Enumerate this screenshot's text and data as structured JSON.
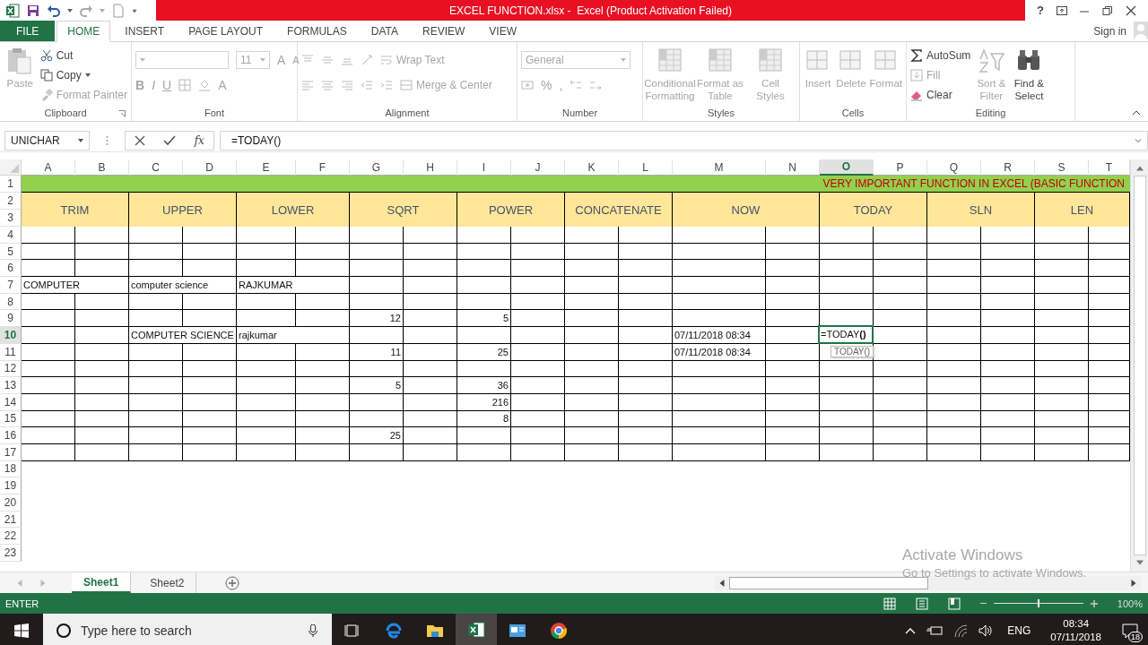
{
  "title_bar": {
    "title": "EXCEL FUNCTION.xlsx -  Excel (Product Activation Failed)",
    "help": "?"
  },
  "menu_tabs": [
    {
      "label": "FILE",
      "kind": "file",
      "selected": false
    },
    {
      "label": "HOME",
      "kind": "tab",
      "selected": true
    },
    {
      "label": "INSERT",
      "kind": "tab",
      "selected": false
    },
    {
      "label": "PAGE LAYOUT",
      "kind": "tab",
      "selected": false
    },
    {
      "label": "FORMULAS",
      "kind": "tab",
      "selected": false
    },
    {
      "label": "DATA",
      "kind": "tab",
      "selected": false
    },
    {
      "label": "REVIEW",
      "kind": "tab",
      "selected": false
    },
    {
      "label": "VIEW",
      "kind": "tab",
      "selected": false
    }
  ],
  "sign_in": "Sign in",
  "ribbon": {
    "clipboard": {
      "title": "Clipboard",
      "paste": {
        "label": "Paste",
        "disabled": true
      },
      "cut": {
        "label": "Cut",
        "disabled": false
      },
      "copy": {
        "label": "Copy",
        "disabled": false
      },
      "format_painter": {
        "label": "Format Painter",
        "disabled": true
      }
    },
    "font": {
      "title": "Font",
      "disabled": true,
      "size": "11",
      "grow": "A",
      "shrink": "A",
      "buttons": [
        "B",
        "I",
        "U"
      ],
      "font_color_glyph": "A"
    },
    "alignment": {
      "title": "Alignment",
      "disabled": true,
      "wrap_text": "Wrap Text",
      "merge_center": "Merge & Center"
    },
    "number": {
      "title": "Number",
      "disabled": true,
      "format": "General",
      "percent": "%",
      "comma": ","
    },
    "styles": {
      "title": "Styles",
      "disabled": true,
      "items": [
        "Conditional Formatting",
        "Format as Table",
        "Cell Styles"
      ]
    },
    "cells": {
      "title": "Cells",
      "disabled": true,
      "items": [
        "Insert",
        "Delete",
        "Format"
      ]
    },
    "editing": {
      "title": "Editing",
      "autosum": {
        "label": "AutoSum",
        "disabled": false
      },
      "fill": {
        "label": "Fill",
        "disabled": true
      },
      "clear": {
        "label": "Clear",
        "disabled": false
      },
      "sort_filter": {
        "label": "Sort & Filter",
        "disabled": true
      },
      "find_select": {
        "label": "Find & Select",
        "disabled": false
      }
    }
  },
  "formula_bar": {
    "name_box": "UNICHAR",
    "fx": "fx",
    "formula": "=TODAY()"
  },
  "sheet": {
    "columns": [
      {
        "label": "A",
        "selected": false
      },
      {
        "label": "B",
        "selected": false
      },
      {
        "label": "C",
        "selected": false
      },
      {
        "label": "D",
        "selected": false
      },
      {
        "label": "E",
        "selected": false
      },
      {
        "label": "F",
        "selected": false
      },
      {
        "label": "G",
        "selected": false
      },
      {
        "label": "H",
        "selected": false
      },
      {
        "label": "I",
        "selected": false
      },
      {
        "label": "J",
        "selected": false
      },
      {
        "label": "K",
        "selected": false
      },
      {
        "label": "L",
        "selected": false
      },
      {
        "label": "M",
        "selected": false
      },
      {
        "label": "N",
        "selected": false
      },
      {
        "label": "O",
        "selected": true
      },
      {
        "label": "P",
        "selected": false
      },
      {
        "label": "Q",
        "selected": false
      },
      {
        "label": "R",
        "selected": false
      },
      {
        "label": "S",
        "selected": false
      },
      {
        "label": "T",
        "selected": false
      }
    ],
    "row_numbers": [
      {
        "label": "1",
        "selected": false
      },
      {
        "label": "2",
        "selected": false
      },
      {
        "label": "3",
        "selected": false
      },
      {
        "label": "4",
        "selected": false
      },
      {
        "label": "5",
        "selected": false
      },
      {
        "label": "6",
        "selected": false
      },
      {
        "label": "7",
        "selected": false
      },
      {
        "label": "8",
        "selected": false
      },
      {
        "label": "9",
        "selected": false
      },
      {
        "label": "10",
        "selected": true
      },
      {
        "label": "11",
        "selected": false
      },
      {
        "label": "12",
        "selected": false
      },
      {
        "label": "13",
        "selected": false
      },
      {
        "label": "14",
        "selected": false
      },
      {
        "label": "15",
        "selected": false
      },
      {
        "label": "16",
        "selected": false
      },
      {
        "label": "17",
        "selected": false
      },
      {
        "label": "18",
        "selected": false
      },
      {
        "label": "19",
        "selected": false
      },
      {
        "label": "20",
        "selected": false
      },
      {
        "label": "21",
        "selected": false
      },
      {
        "label": "22",
        "selected": false
      },
      {
        "label": "23",
        "selected": false
      }
    ],
    "banner": "VERY IMPORTANT FUNCTION IN EXCEL (BASIC FUNCTION",
    "headers": [
      "TRIM",
      "UPPER",
      "LOWER",
      "SQRT",
      "POWER",
      "CONCATENATE",
      "NOW",
      "TODAY",
      "SLN",
      "LEN"
    ],
    "rows": [
      {
        "cells": []
      },
      {
        "cells": []
      },
      {
        "cells": []
      },
      {
        "cells": [
          {
            "value": "COMPUTER",
            "kind": "text"
          },
          null,
          {
            "value": "computer science",
            "kind": "text"
          },
          null,
          {
            "value": "RAJKUMAR",
            "kind": "text"
          }
        ]
      },
      {
        "cells": []
      },
      {
        "cells": [
          null,
          null,
          null,
          null,
          null,
          null,
          {
            "value": "12",
            "kind": "number"
          },
          null,
          {
            "value": "5",
            "kind": "number"
          }
        ]
      },
      {
        "cells": [
          null,
          null,
          {
            "value": "COMPUTER SCIENCE",
            "kind": "text"
          },
          null,
          {
            "value": "rajkumar",
            "kind": "text"
          },
          null,
          null,
          null,
          null,
          null,
          null,
          null,
          {
            "value": "07/11/2018 08:34",
            "kind": "date"
          },
          null,
          {
            "value": "=TODAY**()**",
            "kind": "editing",
            "selected": true
          }
        ]
      },
      {
        "cells": [
          null,
          null,
          null,
          null,
          null,
          null,
          {
            "value": "11",
            "kind": "number"
          },
          null,
          {
            "value": "25",
            "kind": "number"
          },
          null,
          null,
          null,
          {
            "value": "07/11/2018 08:34",
            "kind": "date"
          },
          null,
          {
            "value": "TODAY()",
            "kind": "tooltip"
          }
        ]
      },
      {
        "cells": []
      },
      {
        "cells": [
          null,
          null,
          null,
          null,
          null,
          null,
          {
            "value": "5",
            "kind": "number"
          },
          null,
          {
            "value": "36",
            "kind": "number"
          }
        ]
      },
      {
        "cells": [
          null,
          null,
          null,
          null,
          null,
          null,
          null,
          null,
          {
            "value": "216",
            "kind": "number"
          }
        ]
      },
      {
        "cells": [
          null,
          null,
          null,
          null,
          null,
          null,
          null,
          null,
          {
            "value": "8",
            "kind": "number"
          }
        ]
      },
      {
        "cells": [
          null,
          null,
          null,
          null,
          null,
          null,
          {
            "value": "25",
            "kind": "number"
          }
        ]
      },
      {
        "cells": []
      }
    ]
  },
  "sheet_tabs": [
    {
      "label": "Sheet1",
      "selected": true
    },
    {
      "label": "Sheet2",
      "selected": false
    }
  ],
  "status_bar": {
    "mode": "ENTER",
    "zoom": {
      "level": 0.5
    },
    "zoom_label": "100%"
  },
  "activation_notice": {
    "title": "Activate Windows",
    "message": "Go to Settings to activate Windows."
  },
  "taskbar": {
    "search_placeholder": "Type here to search",
    "apps": [
      {
        "kind": "taskview",
        "selected": false
      },
      {
        "kind": "browser",
        "selected": false
      },
      {
        "kind": "folder",
        "selected": false
      },
      {
        "kind": "spreadsheet",
        "selected": true
      },
      {
        "kind": "window",
        "selected": false
      },
      {
        "kind": "globe",
        "selected": false
      }
    ],
    "language": "ENG",
    "time": "08:34",
    "date": "07/11/2018",
    "notifications": "18"
  }
}
